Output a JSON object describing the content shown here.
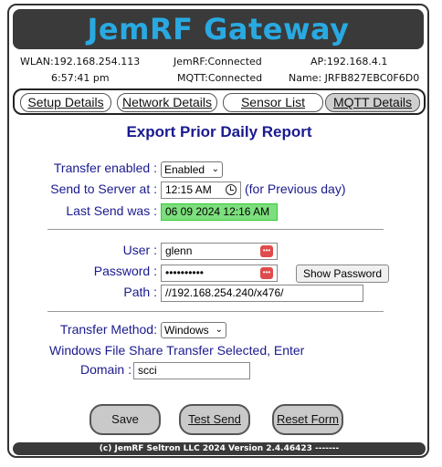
{
  "header": {
    "title": "JemRF Gateway"
  },
  "status": {
    "wlan": "WLAN:192.168.254.113",
    "jemrf": "JemRF:Connected",
    "ap": "AP:192.168.4.1",
    "time": "6:57:41 pm",
    "mqtt": "MQTT:Connected",
    "name": "Name: JRFB827EBC0F6D0"
  },
  "tabs": [
    {
      "label": "Setup Details"
    },
    {
      "label": "Network Details"
    },
    {
      "label": "Sensor List"
    },
    {
      "label": "MQTT Details"
    }
  ],
  "form": {
    "title": "Export Prior Daily Report",
    "transfer_enabled_label": "Transfer enabled :",
    "transfer_enabled_value": "Enabled",
    "send_to_server_label": "Send to Server at :",
    "send_time_value": "12:15 AM",
    "previous_day_note": "(for Previous day)",
    "last_send_label": "Last Send was :",
    "last_send_value": "06 09 2024 12:16 AM",
    "user_label": "User :",
    "user_value": "glenn",
    "password_label": "Password :",
    "password_value": "••••••••••",
    "show_password_label": "Show Password",
    "path_label": "Path :",
    "path_value": "//192.168.254.240/x476/",
    "transfer_method_label": "Transfer Method:",
    "transfer_method_value": "Windows",
    "windows_note": "Windows File Share Transfer Selected, Enter",
    "domain_label": "Domain :",
    "domain_value": "scci"
  },
  "actions": {
    "save_label": "Save",
    "test_send_label": "Test Send",
    "reset_label": "Reset Form"
  },
  "footer": {
    "text": "(c) JemRF Seltron LLC 2024 Version 2.4.46423   -------"
  },
  "colors": {
    "accent_title": "#29a9e1",
    "label_blue": "#1a1a8f",
    "banner_bg": "#3a3a3a",
    "green_field": "#7dde7d"
  }
}
